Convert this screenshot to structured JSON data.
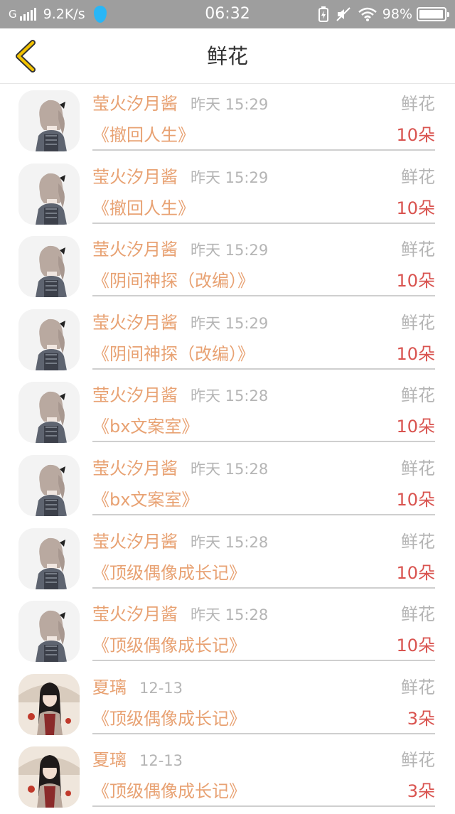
{
  "status_bar": {
    "network": "G",
    "speed": "9.2K/s",
    "time": "06:32",
    "battery_percent": "98%",
    "battery_level": 0.98,
    "icons": [
      "signal-icon",
      "water-drop-icon",
      "battery-saver-icon",
      "mute-icon",
      "wifi-icon",
      "battery-icon"
    ]
  },
  "header": {
    "title": "鲜花",
    "back_icon": "chevron-left-icon",
    "accent_color": "#f2c200"
  },
  "colors": {
    "name": "#e8a273",
    "count": "#d9534f",
    "muted": "#b5b5b5"
  },
  "items": [
    {
      "name": "莹火汐月酱",
      "time": "昨天 15:29",
      "type": "鲜花",
      "book": "《撤回人生》",
      "count": "10朵",
      "avatar": "girl-avatar"
    },
    {
      "name": "莹火汐月酱",
      "time": "昨天 15:29",
      "type": "鲜花",
      "book": "《撤回人生》",
      "count": "10朵",
      "avatar": "girl-avatar"
    },
    {
      "name": "莹火汐月酱",
      "time": "昨天 15:29",
      "type": "鲜花",
      "book": "《阴间神探（改编）》",
      "count": "10朵",
      "avatar": "girl-avatar"
    },
    {
      "name": "莹火汐月酱",
      "time": "昨天 15:29",
      "type": "鲜花",
      "book": "《阴间神探（改编）》",
      "count": "10朵",
      "avatar": "girl-avatar"
    },
    {
      "name": "莹火汐月酱",
      "time": "昨天 15:28",
      "type": "鲜花",
      "book": "《bx文案室》",
      "count": "10朵",
      "avatar": "girl-avatar"
    },
    {
      "name": "莹火汐月酱",
      "time": "昨天 15:28",
      "type": "鲜花",
      "book": "《bx文案室》",
      "count": "10朵",
      "avatar": "girl-avatar"
    },
    {
      "name": "莹火汐月酱",
      "time": "昨天 15:28",
      "type": "鲜花",
      "book": "《顶级偶像成长记》",
      "count": "10朵",
      "avatar": "girl-avatar"
    },
    {
      "name": "莹火汐月酱",
      "time": "昨天 15:28",
      "type": "鲜花",
      "book": "《顶级偶像成长记》",
      "count": "10朵",
      "avatar": "girl-avatar"
    },
    {
      "name": "夏璃",
      "time": "12-13",
      "type": "鲜花",
      "book": "《顶级偶像成长记》",
      "count": "3朵",
      "avatar": "umbrella-girl-avatar"
    },
    {
      "name": "夏璃",
      "time": "12-13",
      "type": "鲜花",
      "book": "《顶级偶像成长记》",
      "count": "3朵",
      "avatar": "umbrella-girl-avatar"
    }
  ]
}
